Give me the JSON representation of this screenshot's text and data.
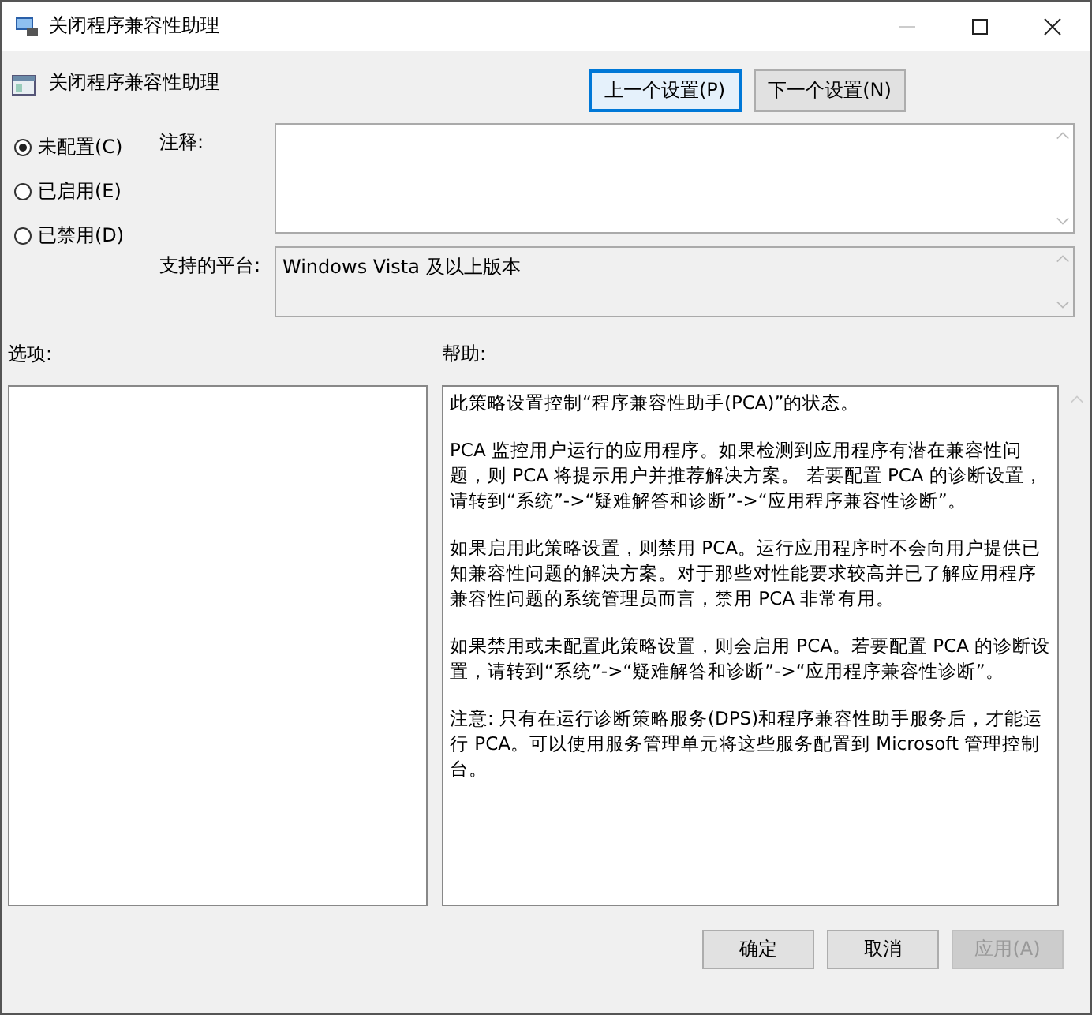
{
  "window": {
    "title": "关闭程序兼容性助理"
  },
  "header": {
    "title": "关闭程序兼容性助理",
    "buttons": [
      {
        "label": "上一个设置(P)",
        "focused": true
      },
      {
        "label": "下一个设置(N)",
        "focused": false
      }
    ]
  },
  "states": [
    {
      "label": "未配置(C)",
      "selected": true
    },
    {
      "label": "已启用(E)",
      "selected": false
    },
    {
      "label": "已禁用(D)",
      "selected": false
    }
  ],
  "comment": {
    "label": "注释:"
  },
  "platform": {
    "label": "支持的平台:",
    "value": "Windows Vista 及以上版本"
  },
  "options": {
    "label": "选项:"
  },
  "help": {
    "label": "帮助:",
    "paragraphs": [
      "此策略设置控制“程序兼容性助手(PCA)”的状态。",
      "PCA 监控用户运行的应用程序。如果检测到应用程序有潜在兼容性问题，则 PCA 将提示用户并推荐解决方案。 若要配置 PCA 的诊断设置，请转到“系统”->“疑难解答和诊断”->“应用程序兼容性诊断”。",
      "如果启用此策略设置，则禁用 PCA。运行应用程序时不会向用户提供已知兼容性问题的解决方案。对于那些对性能要求较高并已了解应用程序兼容性问题的系统管理员而言，禁用 PCA 非常有用。",
      "如果禁用或未配置此策略设置，则会启用 PCA。若要配置 PCA 的诊断设置，请转到“系统”->“疑难解答和诊断”->“应用程序兼容性诊断”。",
      "注意: 只有在运行诊断策略服务(DPS)和程序兼容性助手服务后，才能运行 PCA。可以使用服务管理单元将这些服务配置到 Microsoft 管理控制台。"
    ]
  },
  "footer": {
    "buttons": [
      {
        "label": "确定",
        "disabled": false
      },
      {
        "label": "取消",
        "disabled": false
      },
      {
        "label": "应用(A)",
        "disabled": true
      }
    ]
  }
}
